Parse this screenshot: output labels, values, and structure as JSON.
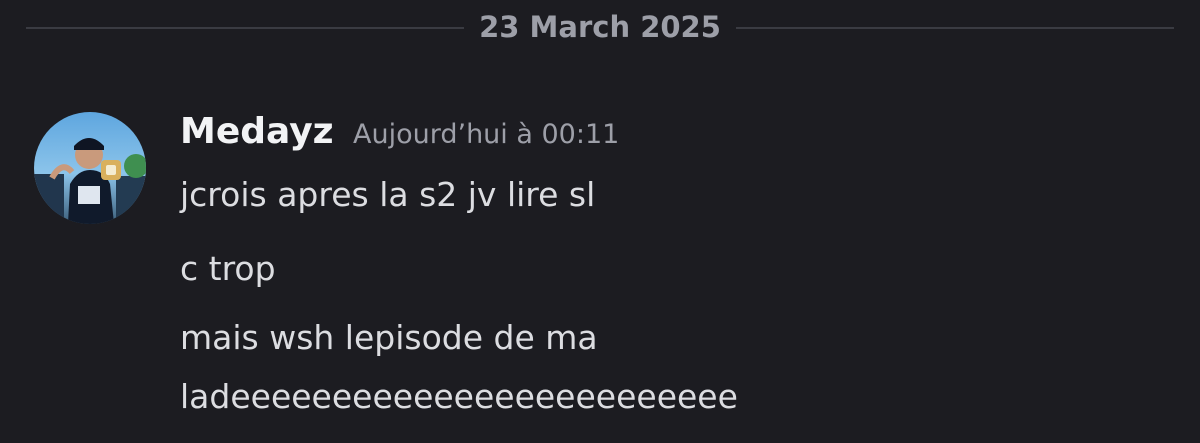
{
  "date_divider": {
    "label": "23 March 2025"
  },
  "message": {
    "author": "Medayz",
    "timestamp": "Aujourd’hui à 00:11",
    "lines": [
      "jcrois apres la s2 jv lire sl",
      "c trop",
      "mais wsh lepisode de ma",
      "ladeeeeeeeeeeeeeeeeeeeeeeeee"
    ]
  },
  "colors": {
    "background": "#1c1c21",
    "divider": "#3a3b42",
    "muted_text": "#9d9fa8",
    "author_text": "#f2f3f5",
    "message_text": "#dcdde1"
  }
}
